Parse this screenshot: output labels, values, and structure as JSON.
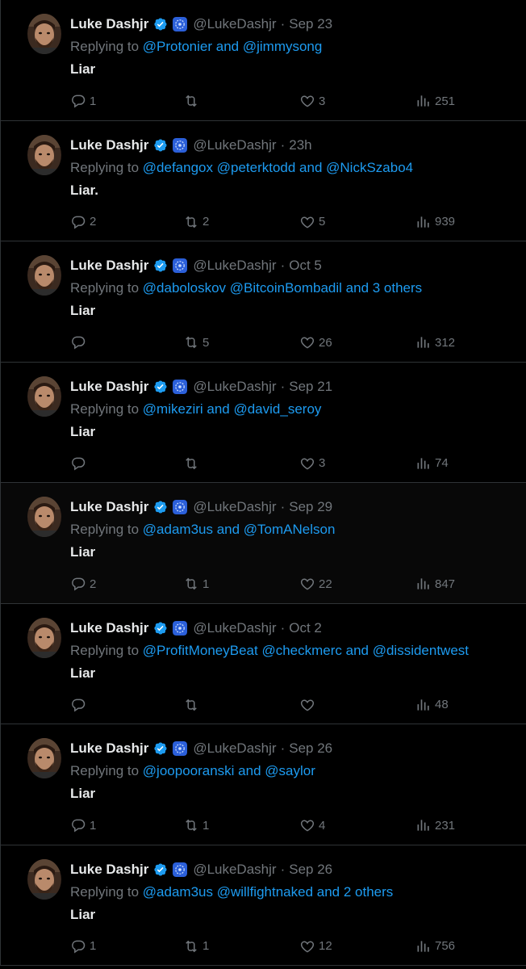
{
  "user": {
    "display_name": "Luke Dashjr",
    "handle": "@LukeDashjr"
  },
  "colors": {
    "background": "#000000",
    "text": "#e7e9ea",
    "muted": "#71767b",
    "link": "#1d9bf0",
    "verified": "#1d9bf0",
    "divider": "#2f3336"
  },
  "icons": [
    "verified-badge-icon",
    "affiliation-badge-icon",
    "reply-icon",
    "retweet-icon",
    "like-icon",
    "views-icon"
  ],
  "tweets": [
    {
      "time": "Sep 23",
      "replying_prefix": "Replying to",
      "mentions": "@Protonier and @jimmysong",
      "text": "Liar",
      "replies": "1",
      "retweets": "",
      "likes": "3",
      "views": "251"
    },
    {
      "time": "23h",
      "replying_prefix": "Replying to",
      "mentions": "@defangox @peterktodd and @NickSzabo4",
      "text": "Liar.",
      "replies": "2",
      "retweets": "2",
      "likes": "5",
      "views": "939"
    },
    {
      "time": "Oct 5",
      "replying_prefix": "Replying to",
      "mentions": "@daboloskov @BitcoinBombadil and 3 others",
      "text": "Liar",
      "replies": "",
      "retweets": "5",
      "likes": "26",
      "views": "312"
    },
    {
      "time": "Sep 21",
      "replying_prefix": "Replying to",
      "mentions": "@mikeziri and @david_seroy",
      "text": "Liar",
      "replies": "",
      "retweets": "",
      "likes": "3",
      "views": "74"
    },
    {
      "time": "Sep 29",
      "replying_prefix": "Replying to",
      "mentions": "@adam3us and @TomANelson",
      "text": "Liar",
      "replies": "2",
      "retweets": "1",
      "likes": "22",
      "views": "847"
    },
    {
      "time": "Oct 2",
      "replying_prefix": "Replying to",
      "mentions": "@ProfitMoneyBeat @checkmerc and @dissidentwest",
      "text": "Liar",
      "replies": "",
      "retweets": "",
      "likes": "",
      "views": "48"
    },
    {
      "time": "Sep 26",
      "replying_prefix": "Replying to",
      "mentions": "@joopooranski and @saylor",
      "text": "Liar",
      "replies": "1",
      "retweets": "1",
      "likes": "4",
      "views": "231"
    },
    {
      "time": "Sep 26",
      "replying_prefix": "Replying to",
      "mentions": "@adam3us @willfightnaked and 2 others",
      "text": "Liar",
      "replies": "1",
      "retweets": "1",
      "likes": "12",
      "views": "756"
    }
  ]
}
